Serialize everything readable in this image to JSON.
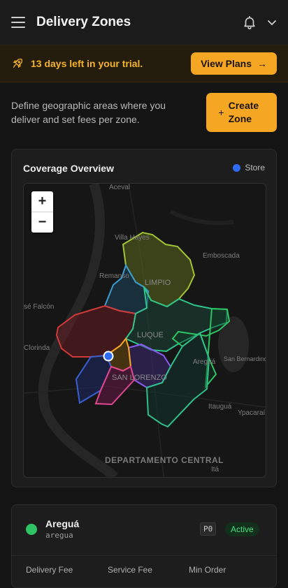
{
  "header": {
    "title": "Delivery Zones",
    "icons": [
      "menu-icon",
      "bell-icon",
      "chevron-down-icon"
    ]
  },
  "trial_banner": {
    "message": "13 days left in your trial.",
    "button_label": "View Plans",
    "button_arrow": "→",
    "icon": "rocket-icon"
  },
  "intro": {
    "text": "Define geographic areas where you deliver and set fees per zone.",
    "create_label": "Create Zone",
    "create_icon": "+"
  },
  "overview": {
    "title": "Coverage Overview",
    "legend_label": "Store",
    "zoom_in": "+",
    "zoom_out": "−",
    "place_labels": [
      "Aceval",
      "Villa Hayes",
      "Emboscada",
      "Remanso",
      "LIMPIO",
      "sé Falcón",
      "Clorinda",
      "LUQUE",
      "Areguá",
      "San Bernardino",
      "SAN LORENZO",
      "Itauguá",
      "Ypacaraí",
      "DEPARTAMENTO CENTRAL",
      "Itá"
    ]
  },
  "zone": {
    "name": "Areguá",
    "slug": "aregua",
    "priority": "P0",
    "status": "Active",
    "columns": [
      "Delivery Fee",
      "Service Fee",
      "Min Order"
    ]
  },
  "colors": {
    "accent": "#f5a623",
    "store": "#2e6df2",
    "active": "#2fc463"
  }
}
